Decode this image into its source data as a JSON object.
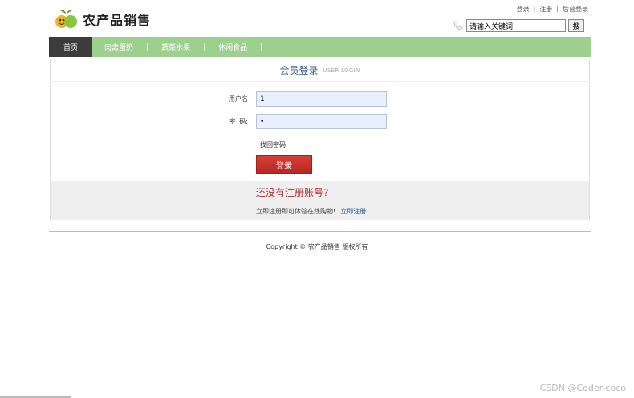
{
  "header": {
    "site_name": "农产品销售",
    "logo_icon": "fruit-logo-icon"
  },
  "toplinks": {
    "login": "登录",
    "register": "注册",
    "admin_login": "后台登录",
    "separator": "|"
  },
  "search": {
    "value": "请输入关键词",
    "button_label": "搜"
  },
  "nav": {
    "items": [
      {
        "label": "首页",
        "active": true
      },
      {
        "label": "肉禽蛋奶"
      },
      {
        "label": "蔬菜水果"
      },
      {
        "label": "休闲食品"
      }
    ],
    "separator": "|",
    "color": "#9dcf8f",
    "active_color": "#3c3c3c"
  },
  "login_panel": {
    "title": "会员登录",
    "subtitle": "USER LOGIN",
    "username_label": "用户名",
    "username_value": "1",
    "password_label": "密  码:",
    "password_value": "•",
    "forgot_label": "找回密码",
    "submit_label": "登录"
  },
  "register_prompt": {
    "title": "还没有注册账号?",
    "text": "立即注册即可体验在线购物!",
    "link": "立即注册"
  },
  "footer": {
    "copyright": "Copyright © 农产品销售 版权所有"
  },
  "watermark": "CSDN @Coder-coco"
}
